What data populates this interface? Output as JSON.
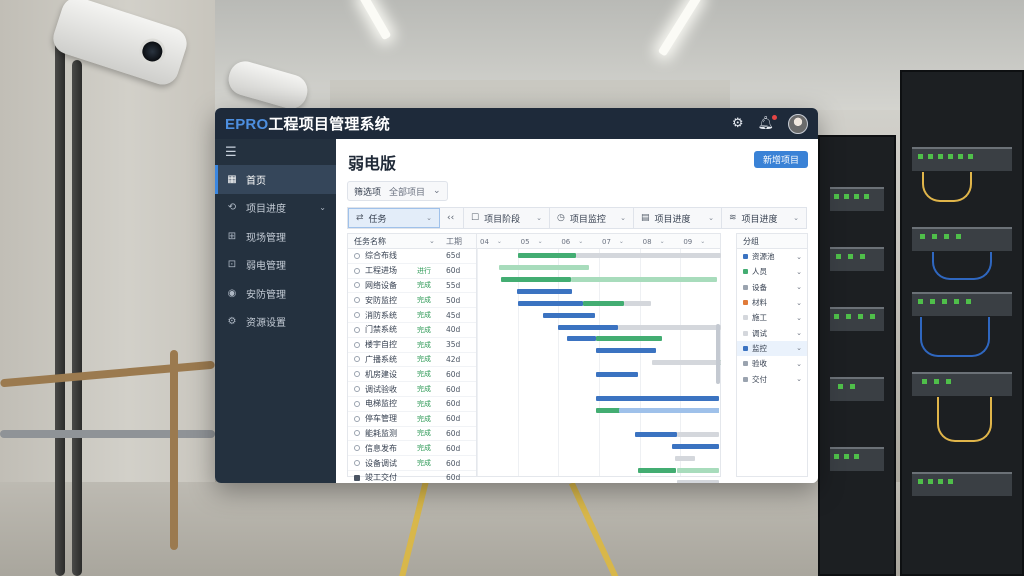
{
  "app": {
    "brand": "EPRO",
    "title_rest": "工程项目管理系统",
    "icons": [
      "gear-icon",
      "bell-icon",
      "avatar"
    ],
    "accent": "#3a82d6",
    "topbar_color": "#1e2a3a",
    "sidebar_color": "#24313f"
  },
  "sidebar": {
    "menu_icon": "☰",
    "items": [
      {
        "label": "首页",
        "icon": "grid-icon",
        "active": true
      },
      {
        "label": "项目进度",
        "icon": "progress-icon",
        "active": false
      },
      {
        "label": "现场管理",
        "icon": "site-icon",
        "active": false
      },
      {
        "label": "弱电管理",
        "icon": "network-icon",
        "active": false
      },
      {
        "label": "安防管理",
        "icon": "camera-icon",
        "active": false
      },
      {
        "label": "资源设置",
        "icon": "settings-icon",
        "active": false
      }
    ]
  },
  "main": {
    "page_title": "弱电版",
    "primary_button": "新增项目",
    "filter": {
      "label": "筛选项",
      "value": "全部项目"
    },
    "toolbar": [
      {
        "label": "任务",
        "icon": "task-icon"
      },
      {
        "label": "",
        "icon": "back-icon"
      },
      {
        "label": "项目阶段",
        "icon": "stage-icon"
      },
      {
        "label": "项目监控",
        "icon": "monitor-icon"
      },
      {
        "label": "项目进度",
        "icon": "progress-icon"
      },
      {
        "label": "项目进度",
        "icon": "wifi-icon"
      }
    ],
    "task_table": {
      "header": "任务名称",
      "duration_header": "工期",
      "rows": [
        {
          "name": "综合布线",
          "status": "",
          "duration": "65d"
        },
        {
          "name": "工程进场",
          "status": "进行",
          "duration": "60d"
        },
        {
          "name": "网络设备",
          "status": "完成",
          "duration": "55d"
        },
        {
          "name": "安防监控",
          "status": "完成",
          "duration": "50d"
        },
        {
          "name": "消防系统",
          "status": "完成",
          "duration": "45d"
        },
        {
          "name": "门禁系统",
          "status": "完成",
          "duration": "40d"
        },
        {
          "name": "楼宇自控",
          "status": "完成",
          "duration": "35d"
        },
        {
          "name": "广播系统",
          "status": "完成",
          "duration": "42d"
        },
        {
          "name": "机房建设",
          "status": "完成",
          "duration": "60d"
        },
        {
          "name": "调试验收",
          "status": "完成",
          "duration": "60d"
        },
        {
          "name": "电梯监控",
          "status": "完成",
          "duration": "60d"
        },
        {
          "name": "停车管理",
          "status": "完成",
          "duration": "60d"
        },
        {
          "name": "能耗监测",
          "status": "完成",
          "duration": "60d"
        },
        {
          "name": "信息发布",
          "status": "完成",
          "duration": "60d"
        },
        {
          "name": "设备调试",
          "status": "完成",
          "duration": "60d"
        },
        {
          "name": "竣工交付",
          "status": "",
          "duration": "60d"
        }
      ]
    },
    "gantt_columns": [
      "04",
      "05",
      "06",
      "07",
      "08",
      "09"
    ],
    "gantt_colors": {
      "blue": "#3b73c1",
      "green": "#43ad72",
      "light_green": "#a8dcbc",
      "gray": "#d4d7dc",
      "light_blue": "#9fc1ea"
    },
    "resource_panel": {
      "header": "分组",
      "items": [
        {
          "label": "资源池",
          "color": "#3b73c1"
        },
        {
          "label": "人员",
          "color": "#43ad72"
        },
        {
          "label": "设备",
          "color": "#9aa3af"
        },
        {
          "label": "材料",
          "color": "#e07b39"
        },
        {
          "label": "施工",
          "color": "#d4d7dc"
        },
        {
          "label": "调试",
          "color": "#d4d7dc"
        },
        {
          "label": "监控",
          "color": "#3b73c1"
        },
        {
          "label": "验收",
          "color": "#9aa3af"
        },
        {
          "label": "交付",
          "color": "#9aa3af"
        }
      ]
    }
  }
}
